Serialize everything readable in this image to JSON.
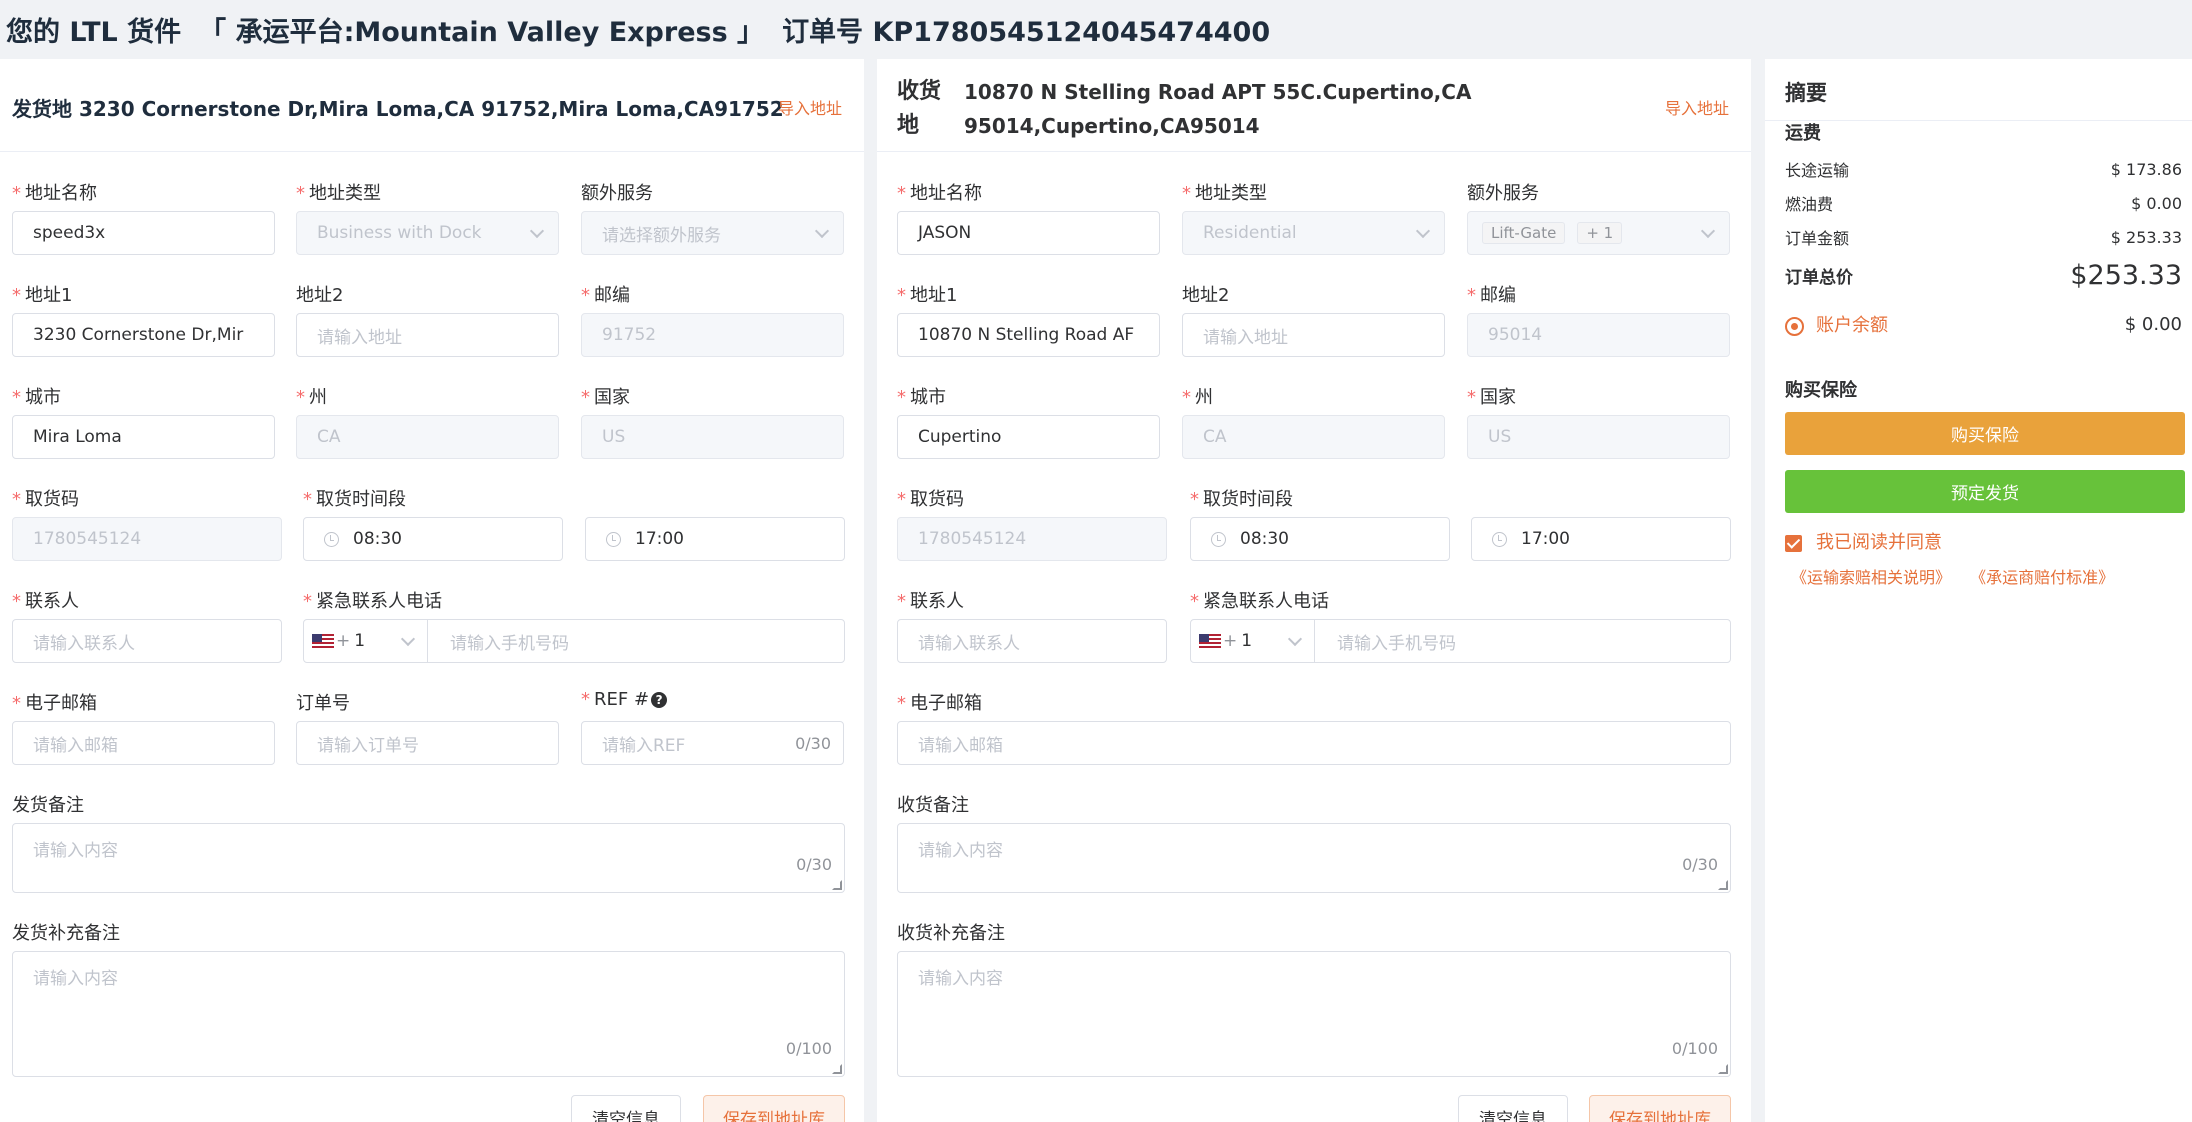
{
  "header": {
    "title": "您的 LTL 货件",
    "carrier": "「 承运平台:Mountain Valley Express 」",
    "order": "订单号 KP1780545124045474400"
  },
  "shipper": {
    "head_title": "发货地 3230 Cornerstone Dr,Mira Loma,CA 91752,Mira Loma,CA91752",
    "import_label": "导入地址",
    "address_name": {
      "label": "地址名称",
      "value": "speed3x"
    },
    "address_type": {
      "label": "地址类型",
      "value": "Business with Dock"
    },
    "extra_service": {
      "label": "额外服务",
      "placeholder": "请选择额外服务"
    },
    "address1": {
      "label": "地址1",
      "value": "3230 Cornerstone Dr,Mir"
    },
    "address2": {
      "label": "地址2",
      "placeholder": "请输入地址"
    },
    "zip": {
      "label": "邮编",
      "value": "91752"
    },
    "city": {
      "label": "城市",
      "value": "Mira Loma"
    },
    "state": {
      "label": "州",
      "value": "CA"
    },
    "country": {
      "label": "国家",
      "value": "US"
    },
    "code": {
      "label": "取货码",
      "value": "1780545124"
    },
    "time": {
      "label": "取货时间段",
      "start": "08:30",
      "end": "17:00"
    },
    "contact": {
      "label": "联系人",
      "placeholder": "请输入联系人"
    },
    "phone": {
      "label": "紧急联系人电话",
      "code_plus": "+",
      "code": "1",
      "placeholder": "请输入手机号码"
    },
    "email": {
      "label": "电子邮箱",
      "placeholder": "请输入邮箱"
    },
    "order_no": {
      "label": "订单号",
      "placeholder": "请输入订单号"
    },
    "ref": {
      "label": "REF #",
      "placeholder": "请输入REF",
      "counter": "0/30"
    },
    "note": {
      "label": "发货备注",
      "placeholder": "请输入内容",
      "counter": "0/30"
    },
    "extra_note": {
      "label": "发货补充备注",
      "placeholder": "请输入内容",
      "counter": "0/100"
    },
    "clear_label": "清空信息",
    "save_label": "保存到地址库"
  },
  "consignee": {
    "head_key": "收货地",
    "head_addr": "10870 N Stelling Road APT 55C.Cupertino,CA 95014,Cupertino,CA95014",
    "import_label": "导入地址",
    "address_name": {
      "label": "地址名称",
      "value": "JASON"
    },
    "address_type": {
      "label": "地址类型",
      "value": "Residential"
    },
    "extra_service": {
      "label": "额外服务",
      "tag": "Lift-Gate",
      "more": "+ 1"
    },
    "address1": {
      "label": "地址1",
      "value": "10870 N Stelling Road AF"
    },
    "address2": {
      "label": "地址2",
      "placeholder": "请输入地址"
    },
    "zip": {
      "label": "邮编",
      "value": "95014"
    },
    "city": {
      "label": "城市",
      "value": "Cupertino"
    },
    "state": {
      "label": "州",
      "value": "CA"
    },
    "country": {
      "label": "国家",
      "value": "US"
    },
    "code": {
      "label": "取货码",
      "value": "1780545124"
    },
    "time": {
      "label": "取货时间段",
      "start": "08:30",
      "end": "17:00"
    },
    "contact": {
      "label": "联系人",
      "placeholder": "请输入联系人"
    },
    "phone": {
      "label": "紧急联系人电话",
      "code_plus": "+",
      "code": "1",
      "placeholder": "请输入手机号码"
    },
    "email": {
      "label": "电子邮箱",
      "placeholder": "请输入邮箱"
    },
    "note": {
      "label": "收货备注",
      "placeholder": "请输入内容",
      "counter": "0/30"
    },
    "extra_note": {
      "label": "收货补充备注",
      "placeholder": "请输入内容",
      "counter": "0/100"
    },
    "clear_label": "清空信息",
    "save_label": "保存到地址库"
  },
  "summary": {
    "title": "摘要",
    "freight_title": "运费",
    "rows": [
      {
        "label": "长途运输",
        "value": "$ 173.86"
      },
      {
        "label": "燃油费",
        "value": "$ 0.00"
      },
      {
        "label": "订单金额",
        "value": "$ 253.33"
      }
    ],
    "total_label": "订单总价",
    "total_value": "$253.33",
    "balance_label": "账户余额",
    "balance_value": "$ 0.00",
    "insurance_title": "购买保险",
    "insurance_button": "购买保险",
    "book_button": "预定发货",
    "agree_label": "我已阅读并同意",
    "link1": "《运输索赔相关说明》",
    "link2": "《承运商赔付标准》",
    "colors": {
      "accent": "#e6713b",
      "insurance": "#e9a23b",
      "book": "#67c23a"
    }
  }
}
